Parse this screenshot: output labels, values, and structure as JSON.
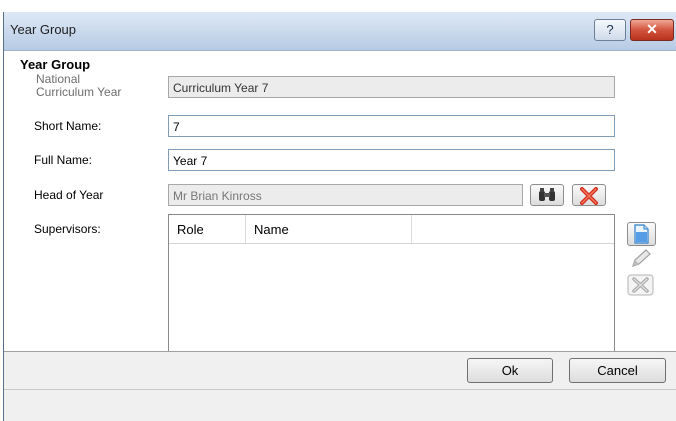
{
  "window": {
    "title": "Year Group",
    "help_label": "?",
    "close_label": "✕"
  },
  "form": {
    "group_title": "Year Group",
    "national_curriculum_label_1": "National",
    "national_curriculum_label_2": "Curriculum Year",
    "national_curriculum_value": "Curriculum Year  7",
    "short_name_label": "Short Name:",
    "short_name_value": "7",
    "full_name_label": "Full Name:",
    "full_name_value": "Year  7",
    "head_of_year_label": "Head of Year",
    "head_of_year_value": "Mr Brian Kinross",
    "supervisors_label": "Supervisors:"
  },
  "supervisors_grid": {
    "columns": [
      "Role",
      "Name",
      ""
    ],
    "rows": []
  },
  "buttons": {
    "ok": "Ok",
    "cancel": "Cancel"
  },
  "icons": {
    "find": "binoculars-icon",
    "clear": "red-x-icon",
    "new": "new-document-icon",
    "edit": "pencil-icon",
    "delete": "grey-x-icon"
  }
}
